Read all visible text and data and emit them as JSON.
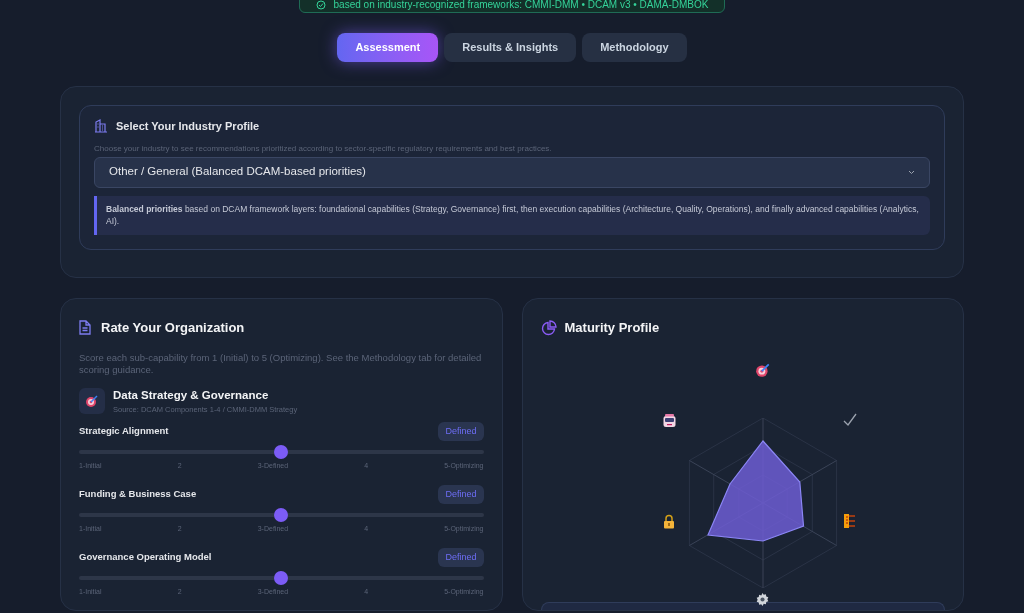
{
  "banner": {
    "text": "based on industry-recognized frameworks: CMMI-DMM • DCAM v3 • DAMA-DMBOK"
  },
  "tabs": [
    {
      "label": "Assessment",
      "selected": true
    },
    {
      "label": "Results & Insights",
      "selected": false
    },
    {
      "label": "Methodology",
      "selected": false
    }
  ],
  "industry": {
    "title": "Select Your Industry Profile",
    "description": "Choose your industry to see recommendations prioritized according to sector-specific regulatory requirements and best practices.",
    "selected_option": "Other / General (Balanced DCAM-based priorities)",
    "note": "**Balanced priorities** based on DCAM framework layers: foundational capabilities (Strategy, Governance) first, then execution capabilities (Architecture, Quality, Operations), and finally advanced capabilities (Analytics, AI)."
  },
  "rating": {
    "title": "Rate Your Organization",
    "description": "Score each sub-capability from 1 (Initial) to 5 (Optimizing). See the Methodology tab for detailed scoring guidance.",
    "category": {
      "name": "Data Strategy & Governance",
      "source": "Source: DCAM Components 1-4 / CMMI-DMM Strategy"
    },
    "items": [
      {
        "label": "Strategic Alignment",
        "badge": "Defined",
        "level": 0.5,
        "scale": [
          "1-Initial",
          "2",
          "3-Defined",
          "4",
          "5-Optimizing"
        ]
      },
      {
        "label": "Funding & Business Case",
        "badge": "Defined",
        "level": 0.5,
        "scale": [
          "1-Initial",
          "2",
          "3-Defined",
          "4",
          "5-Optimizing"
        ]
      },
      {
        "label": "Governance Operating Model",
        "badge": "Defined",
        "level": 0.5,
        "scale": [
          "1-Initial",
          "2",
          "3-Defined",
          "4",
          "5-Optimizing"
        ]
      }
    ]
  },
  "maturity_profile": {
    "title": "Maturity Profile"
  }
}
